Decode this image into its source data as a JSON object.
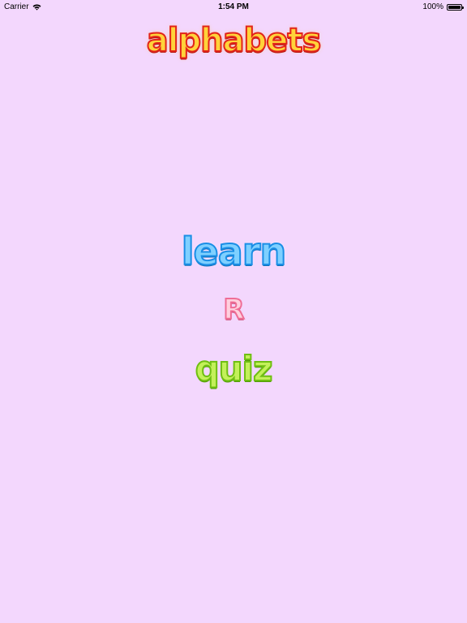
{
  "status_bar": {
    "carrier": "Carrier",
    "time": "1:54 PM",
    "battery_percent": "100%",
    "battery_level": 1.0
  },
  "app": {
    "title": "alphabets",
    "title_color": "#ffd33a",
    "title_outline_color": "#e2231a"
  },
  "menu": {
    "learn_label": "learn",
    "recognition_label": "R",
    "quiz_label": "quiz"
  },
  "colors": {
    "background": "#f3d7fd",
    "learn": "#7fd0ff",
    "recognition": "#ffd0de",
    "quiz": "#c3f05a"
  },
  "icons": {
    "wifi": "wifi-icon",
    "battery": "battery-icon"
  }
}
